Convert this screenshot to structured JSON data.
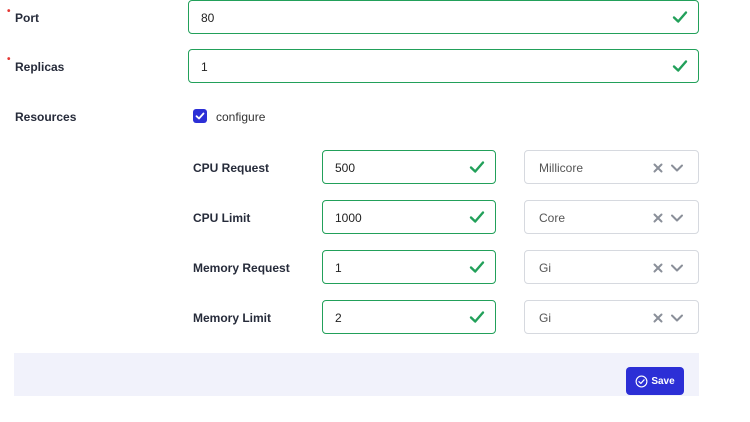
{
  "form": {
    "port": {
      "label": "Port",
      "value": "80"
    },
    "replicas": {
      "label": "Replicas",
      "value": "1"
    },
    "resources": {
      "label": "Resources",
      "checkbox_label": "configure",
      "checked": true
    }
  },
  "resources": [
    {
      "label": "CPU Request",
      "value": "500",
      "unit": "Millicore"
    },
    {
      "label": "CPU Limit",
      "value": "1000",
      "unit": "Core"
    },
    {
      "label": "Memory Request",
      "value": "1",
      "unit": "Gi"
    },
    {
      "label": "Memory Limit",
      "value": "2",
      "unit": "Gi"
    }
  ],
  "footer": {
    "save_label": "Save"
  },
  "colors": {
    "valid": "#22a05a",
    "accent": "#2c2fd6",
    "required": "#e53935"
  },
  "icons": {
    "valid": "check-icon",
    "clear": "close-icon",
    "dropdown": "chevron-down-icon",
    "save": "check-circle-icon"
  }
}
